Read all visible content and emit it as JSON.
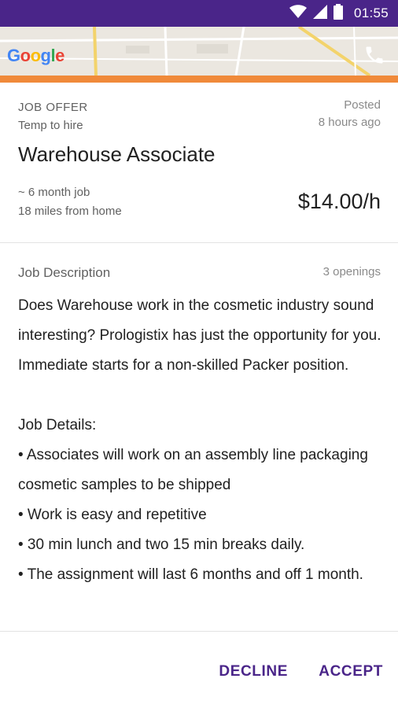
{
  "status_bar": {
    "time": "01:55",
    "icons": [
      "wifi-icon",
      "signal-icon",
      "battery-icon"
    ],
    "background_color": "#4a2589"
  },
  "map": {
    "logo_letters": [
      "G",
      "o",
      "o",
      "g",
      "l",
      "e"
    ],
    "call_icon": "phone-icon"
  },
  "accent_color": "#f08a3a",
  "header": {
    "offer_label": "JOB OFFER",
    "hire_type": "Temp to hire",
    "posted_label": "Posted",
    "posted_time": "8 hours ago",
    "title": "Warehouse Associate",
    "duration": "~ 6 month job",
    "distance": "18 miles from home",
    "pay_rate": "$14.00/h"
  },
  "description": {
    "heading": "Job Description",
    "openings": "3 openings",
    "body": "Does Warehouse work in the cosmetic industry sound interesting? Prologistix has just the opportunity for you. Immediate starts for a non-skilled Packer position.\n\nJob Details:\n• Associates will work on an assembly line packaging cosmetic samples to be shipped\n• Work is easy and repetitive\n• 30 min lunch and two 15 min breaks daily.\n• The assignment will last 6 months and off 1 month."
  },
  "footer": {
    "decline_label": "DECLINE",
    "accept_label": "ACCEPT",
    "button_color": "#4a2589"
  }
}
